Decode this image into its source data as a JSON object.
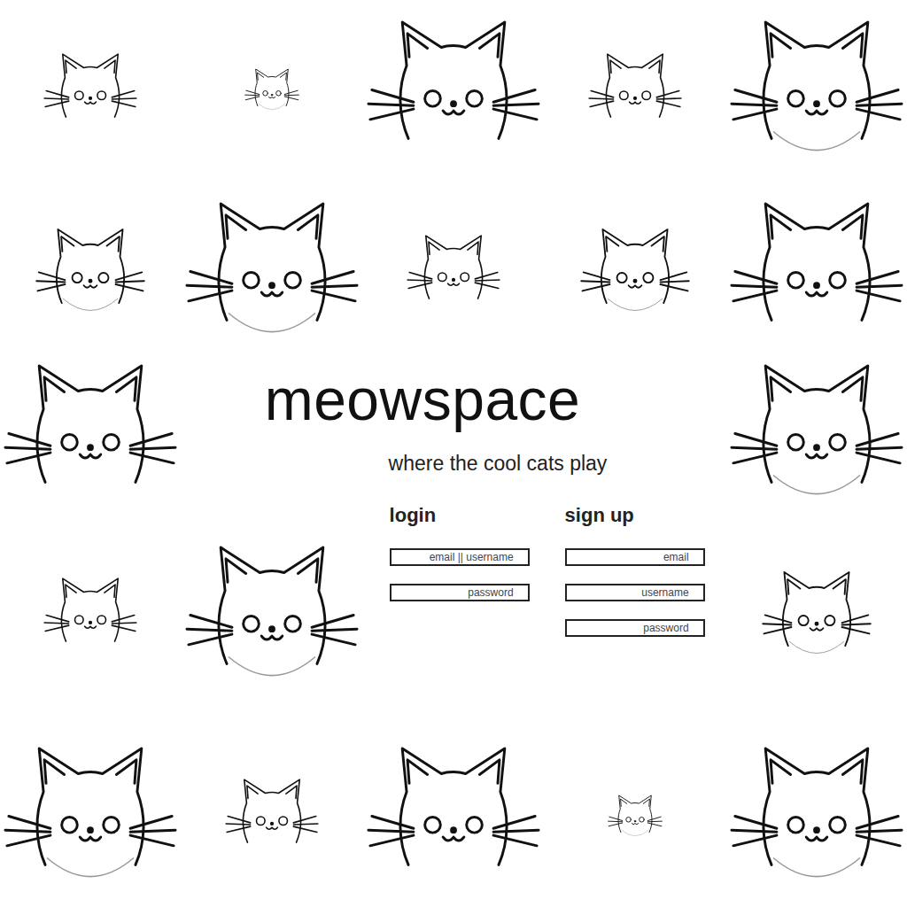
{
  "title": "meowspace",
  "tagline": "where the cool cats play",
  "login": {
    "heading": "login",
    "fields": [
      {
        "placeholder": "email || username"
      },
      {
        "placeholder": "password"
      }
    ]
  },
  "signup": {
    "heading": "sign up",
    "fields": [
      {
        "placeholder": "email"
      },
      {
        "placeholder": "username"
      },
      {
        "placeholder": "password"
      }
    ]
  }
}
